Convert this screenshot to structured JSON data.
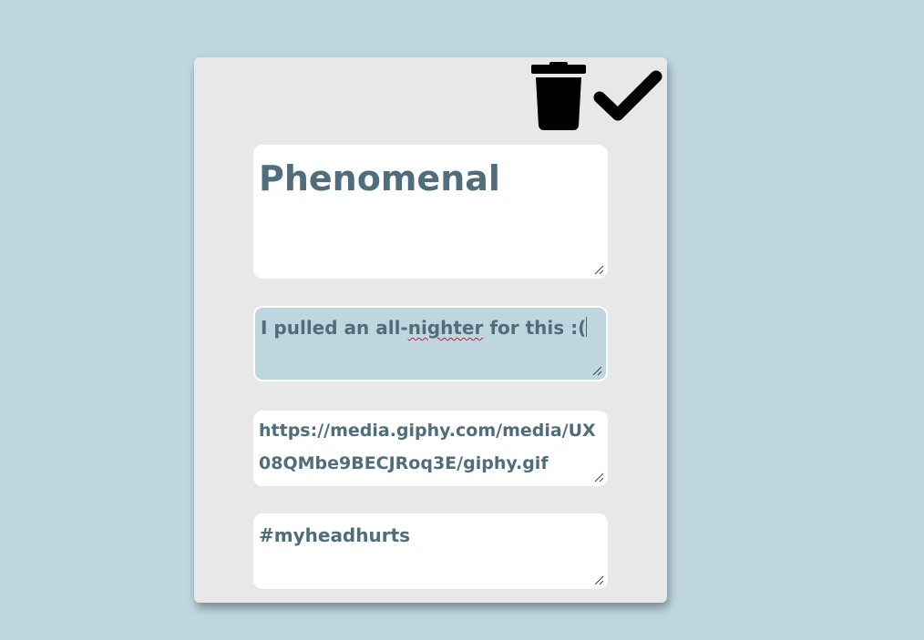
{
  "card": {
    "title_value": "Phenomenal",
    "description_value_before": "I pulled an all-",
    "description_misspelled": "nighter",
    "description_value_after": " for this :(",
    "gif_url_value": "https://media.giphy.com/media/UX08QMbe9BECJRoq3E/giphy.gif",
    "tags_value": "#myheadhurts"
  },
  "icons": {
    "delete": "trash-icon",
    "save": "checkmark-icon"
  },
  "colors": {
    "background": "#c0d6df",
    "card": "#e8e8e8",
    "text": "#4f6d7a",
    "field": "#ffffff",
    "active_field": "#c0d6df",
    "icon": "#000000"
  }
}
